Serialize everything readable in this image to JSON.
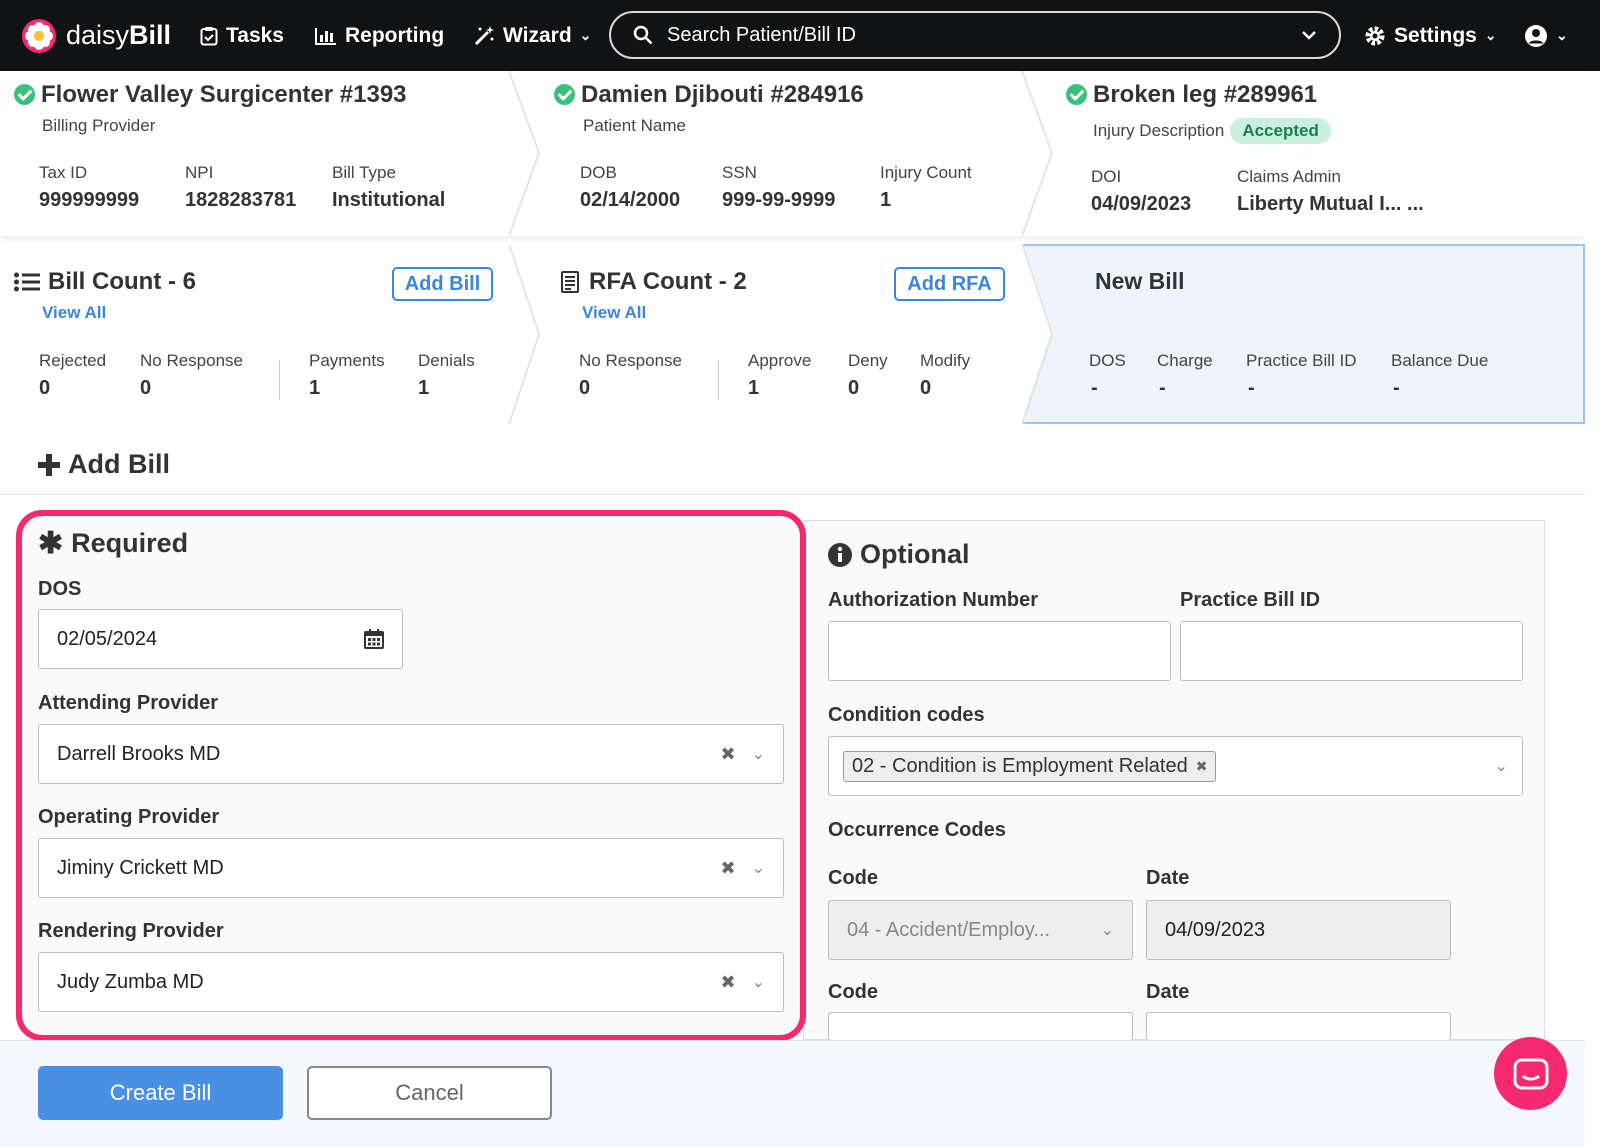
{
  "nav": {
    "brand_part1": "daisy",
    "brand_part2": "Bill",
    "tasks": "Tasks",
    "reporting": "Reporting",
    "wizard": "Wizard",
    "search_placeholder": "Search Patient/Bill ID",
    "settings": "Settings"
  },
  "provider": {
    "title": "Flower Valley Surgicenter #1393",
    "subtitle": "Billing Provider",
    "fields": [
      {
        "label": "Tax ID",
        "value": "999999999"
      },
      {
        "label": "NPI",
        "value": "1828283781"
      },
      {
        "label": "Bill Type",
        "value": "Institutional"
      }
    ]
  },
  "patient": {
    "title": "Damien Djibouti #284916",
    "subtitle": "Patient Name",
    "fields": [
      {
        "label": "DOB",
        "value": "02/14/2000"
      },
      {
        "label": "SSN",
        "value": "999-99-9999"
      },
      {
        "label": "Injury Count",
        "value": "1"
      }
    ]
  },
  "injury": {
    "title": "Broken leg #289961",
    "subtitle": "Injury Description",
    "badge": "Accepted",
    "fields": [
      {
        "label": "DOI",
        "value": "04/09/2023"
      },
      {
        "label": "Claims Admin",
        "value": "Liberty Mutual I... ..."
      }
    ]
  },
  "bills": {
    "title": "Bill Count - 6",
    "add_button": "Add Bill",
    "view_all": "View All",
    "fields": [
      {
        "label": "Rejected",
        "value": "0"
      },
      {
        "label": "No Response",
        "value": "0"
      },
      {
        "label": "Payments",
        "value": "1"
      },
      {
        "label": "Denials",
        "value": "1"
      }
    ]
  },
  "rfa": {
    "title": "RFA Count - 2",
    "add_button": "Add RFA",
    "view_all": "View All",
    "fields": [
      {
        "label": "No Response",
        "value": "0"
      },
      {
        "label": "Approve",
        "value": "1"
      },
      {
        "label": "Deny",
        "value": "0"
      },
      {
        "label": "Modify",
        "value": "0"
      }
    ]
  },
  "new_bill": {
    "title": "New Bill",
    "fields": [
      {
        "label": "DOS",
        "value": "-"
      },
      {
        "label": "Charge",
        "value": "-"
      },
      {
        "label": "Practice Bill ID",
        "value": "-"
      },
      {
        "label": "Balance Due",
        "value": "-"
      }
    ]
  },
  "add_bill_heading": "Add Bill",
  "required": {
    "title": "Required",
    "dos_label": "DOS",
    "dos_value": "02/05/2024",
    "attending_label": "Attending Provider",
    "attending_value": "Darrell Brooks MD",
    "operating_label": "Operating Provider",
    "operating_value": "Jiminy Crickett MD",
    "rendering_label": "Rendering Provider",
    "rendering_value": "Judy Zumba MD"
  },
  "optional": {
    "title": "Optional",
    "auth_label": "Authorization Number",
    "auth_value": "",
    "practice_label": "Practice Bill ID",
    "practice_value": "",
    "condition_label": "Condition codes",
    "condition_tag": "02 - Condition is Employment Related",
    "occurrence_label": "Occurrence Codes",
    "code_label": "Code",
    "date_label": "Date",
    "occ1_code": "04 - Accident/Employ...",
    "occ1_date": "04/09/2023"
  },
  "footer": {
    "create": "Create Bill",
    "cancel": "Cancel"
  },
  "colors": {
    "accent": "#4a90e2",
    "highlight": "#f5296f",
    "success": "#3bbf7a"
  }
}
